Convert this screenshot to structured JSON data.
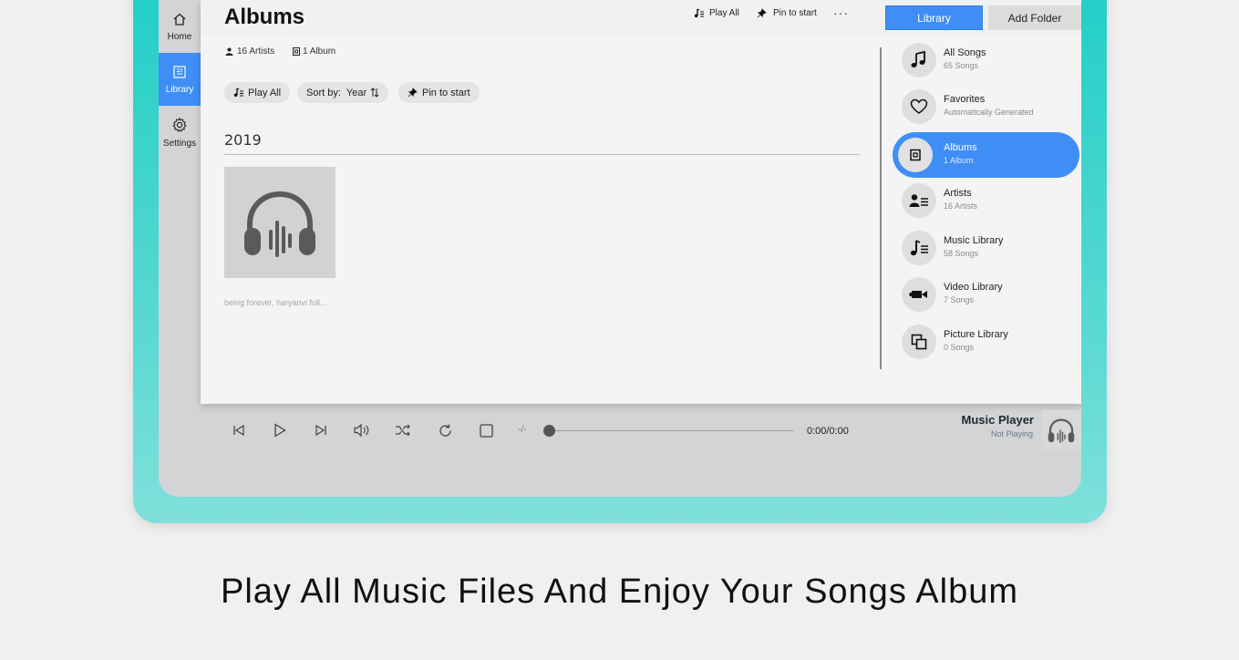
{
  "nav": {
    "items": [
      {
        "label": "Home",
        "icon": "home-icon"
      },
      {
        "label": "Library",
        "icon": "library-icon",
        "active": true
      },
      {
        "label": "Settings",
        "icon": "gear-icon"
      }
    ]
  },
  "header": {
    "title": "Albums",
    "play_all": "Play All",
    "pin_to_start": "Pin to start",
    "more": "···",
    "library_button": "Library",
    "add_folder_button": "Add Folder"
  },
  "stats": {
    "artists": "16 Artists",
    "albums": "1 Album"
  },
  "toolbar": {
    "play_all": "Play All",
    "sort_by_label": "Sort by:",
    "sort_value": "Year",
    "pin_to_start": "Pin to start"
  },
  "section": {
    "year": "2019",
    "album_title": "being forever, haryanvi full..."
  },
  "categories": [
    {
      "name": "All Songs",
      "sub": "65 Songs",
      "icon": "music-note-icon"
    },
    {
      "name": "Favorites",
      "sub": "Automatically Generated",
      "icon": "heart-icon"
    },
    {
      "name": "Albums",
      "sub": "1 Album",
      "icon": "album-icon",
      "active": true
    },
    {
      "name": "Artists",
      "sub": "16 Artists",
      "icon": "artist-icon"
    },
    {
      "name": "Music Library",
      "sub": "58 Songs",
      "icon": "music-list-icon"
    },
    {
      "name": "Video Library",
      "sub": "7 Songs",
      "icon": "video-camera-icon"
    },
    {
      "name": "Picture Library",
      "sub": "0 Songs",
      "icon": "picture-icon"
    }
  ],
  "player": {
    "rate": "-/-",
    "time": "0:00/0:00",
    "title": "Music Player",
    "status": "Not Playing",
    "progress": 0
  },
  "colors": {
    "accent": "#3f8ef6",
    "frame": "#2fd1c9"
  },
  "caption": "Play All Music Files And Enjoy Your Songs Album"
}
